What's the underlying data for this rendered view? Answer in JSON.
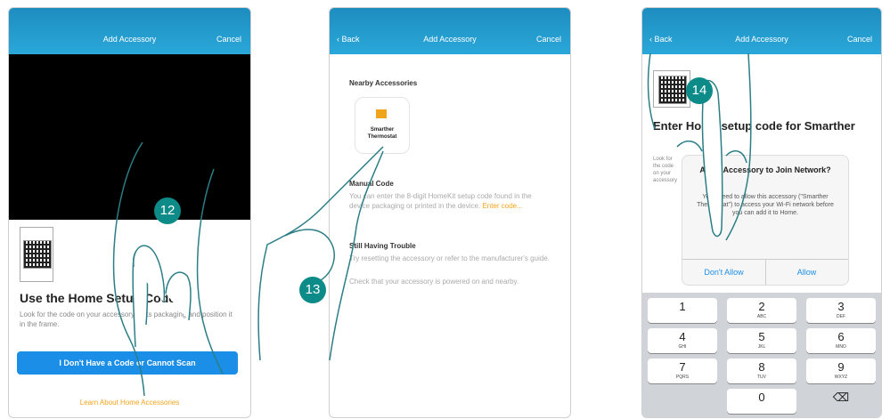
{
  "colors": {
    "navbar": "#2aa7d9",
    "accent": "#1b8ee8",
    "link": "#f0a41c",
    "badge": "#0d8b88"
  },
  "steps": [
    "12",
    "13",
    "14"
  ],
  "screen1": {
    "title": "Add Accessory",
    "cancel": "Cancel",
    "heading": "Use the Home",
    "heading_tail": "Setup Code",
    "body": "Look for the code on your accessory or its packaging and position it in the frame.",
    "button": "I Don't Have a Code or Cannot Scan",
    "link": "Learn About Home Accessories"
  },
  "screen2": {
    "back": "Back",
    "title": "Add Accessory",
    "cancel": "Cancel",
    "section": "Nearby Accessories",
    "tile_line1": "Smarther",
    "tile_line2": "Thermostat",
    "manual_head": "Manual Code",
    "manual_body": "You can enter the 8-digit HomeKit setup code found in the device packaging or printed in the device.",
    "manual_link": "Enter code...",
    "trouble_head": "Still Having Trouble",
    "trouble_body": "Try resetting the accessory or refer to the manufacturer's guide.",
    "trouble_body2": "Check that your accessory is powered on and nearby."
  },
  "screen3": {
    "back": "Back",
    "title": "Add Accessory",
    "cancel": "Cancel",
    "heading": "Enter Home setup code for Smarther",
    "side_text": "Look for the code on your accessory",
    "dialog_title": "Allow Accessory to Join Network?",
    "dialog_msg": "You'll need to allow this accessory (\"Smarther Thermostat\") to access your Wi-Fi network before you can add it to Home.",
    "dont_allow": "Don't Allow",
    "allow": "Allow",
    "keys": [
      {
        "digit": "1",
        "letters": ""
      },
      {
        "digit": "2",
        "letters": "ABC"
      },
      {
        "digit": "3",
        "letters": "DEF"
      },
      {
        "digit": "4",
        "letters": "GHI"
      },
      {
        "digit": "5",
        "letters": "JKL"
      },
      {
        "digit": "6",
        "letters": "MNO"
      },
      {
        "digit": "7",
        "letters": "PQRS"
      },
      {
        "digit": "8",
        "letters": "TUV"
      },
      {
        "digit": "9",
        "letters": "WXYZ"
      },
      {
        "digit": "0",
        "letters": ""
      },
      {
        "digit": "⌫",
        "letters": ""
      }
    ]
  }
}
